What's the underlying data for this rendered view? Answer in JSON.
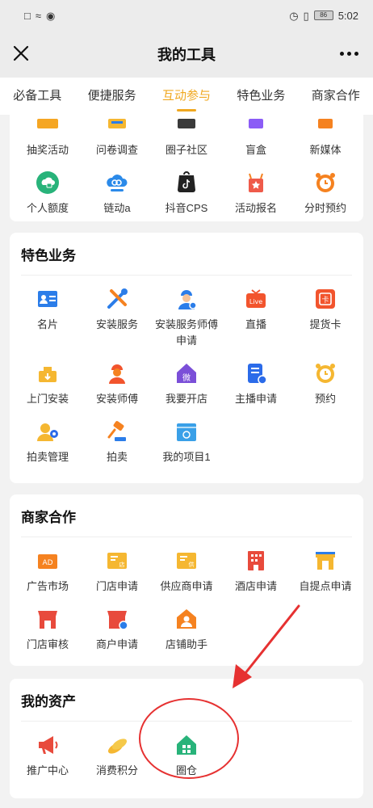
{
  "status_bar": {
    "time": "5:02",
    "battery": "86"
  },
  "header": {
    "title": "我的工具"
  },
  "tabs": [
    {
      "label": "必备工具"
    },
    {
      "label": "便捷服务"
    },
    {
      "label": "互动参与"
    },
    {
      "label": "特色业务"
    },
    {
      "label": "商家合作"
    }
  ],
  "top_section": {
    "items": [
      {
        "label": "抽奖活动",
        "icon": "lottery-icon"
      },
      {
        "label": "问卷调查",
        "icon": "survey-icon"
      },
      {
        "label": "圈子社区",
        "icon": "community-icon"
      },
      {
        "label": "盲盒",
        "icon": "blind-box-icon"
      },
      {
        "label": "新媒体",
        "icon": "new-media-icon"
      },
      {
        "label": "个人额度",
        "icon": "personal-quota-icon"
      },
      {
        "label": "链动a",
        "icon": "link-icon"
      },
      {
        "label": "抖音CPS",
        "icon": "douyin-icon"
      },
      {
        "label": "活动报名",
        "icon": "event-signup-icon"
      },
      {
        "label": "分时预约",
        "icon": "alarm-clock-icon"
      }
    ]
  },
  "feature_section": {
    "title": "特色业务",
    "items": [
      {
        "label": "名片",
        "icon": "business-card-icon"
      },
      {
        "label": "安装服务",
        "icon": "tools-icon"
      },
      {
        "label": "安装服务师傅申请",
        "icon": "worker-apply-icon"
      },
      {
        "label": "直播",
        "icon": "live-icon"
      },
      {
        "label": "提货卡",
        "icon": "pickup-card-icon"
      },
      {
        "label": "上门安装",
        "icon": "home-install-icon"
      },
      {
        "label": "安装师傅",
        "icon": "installer-icon"
      },
      {
        "label": "我要开店",
        "icon": "open-store-icon"
      },
      {
        "label": "主播申请",
        "icon": "anchor-apply-icon"
      },
      {
        "label": "预约",
        "icon": "reservation-clock-icon"
      },
      {
        "label": "拍卖管理",
        "icon": "auction-manage-icon"
      },
      {
        "label": "拍卖",
        "icon": "auction-hammer-icon"
      },
      {
        "label": "我的项目1",
        "icon": "my-project-icon"
      }
    ]
  },
  "merchant_section": {
    "title": "商家合作",
    "items": [
      {
        "label": "广告市场",
        "icon": "ad-market-icon"
      },
      {
        "label": "门店申请",
        "icon": "store-apply-icon"
      },
      {
        "label": "供应商申请",
        "icon": "supplier-apply-icon"
      },
      {
        "label": "酒店申请",
        "icon": "hotel-icon"
      },
      {
        "label": "自提点申请",
        "icon": "pickup-point-icon"
      },
      {
        "label": "门店审核",
        "icon": "store-review-icon"
      },
      {
        "label": "商户申请",
        "icon": "merchant-apply-icon"
      },
      {
        "label": "店铺助手",
        "icon": "shop-assistant-icon"
      }
    ]
  },
  "assets_section": {
    "title": "我的资产",
    "items": [
      {
        "label": "推广中心",
        "icon": "megaphone-icon"
      },
      {
        "label": "消费积分",
        "icon": "points-icon"
      },
      {
        "label": "圈仓",
        "icon": "warehouse-home-icon"
      }
    ]
  },
  "colors": {
    "accent": "#f0a820",
    "annotation": "#e63131",
    "icon_orange": "#f58220",
    "icon_blue": "#2b7de9",
    "icon_red": "#e84a3c",
    "icon_green": "#28b37a",
    "icon_purple": "#7b4fd8"
  }
}
